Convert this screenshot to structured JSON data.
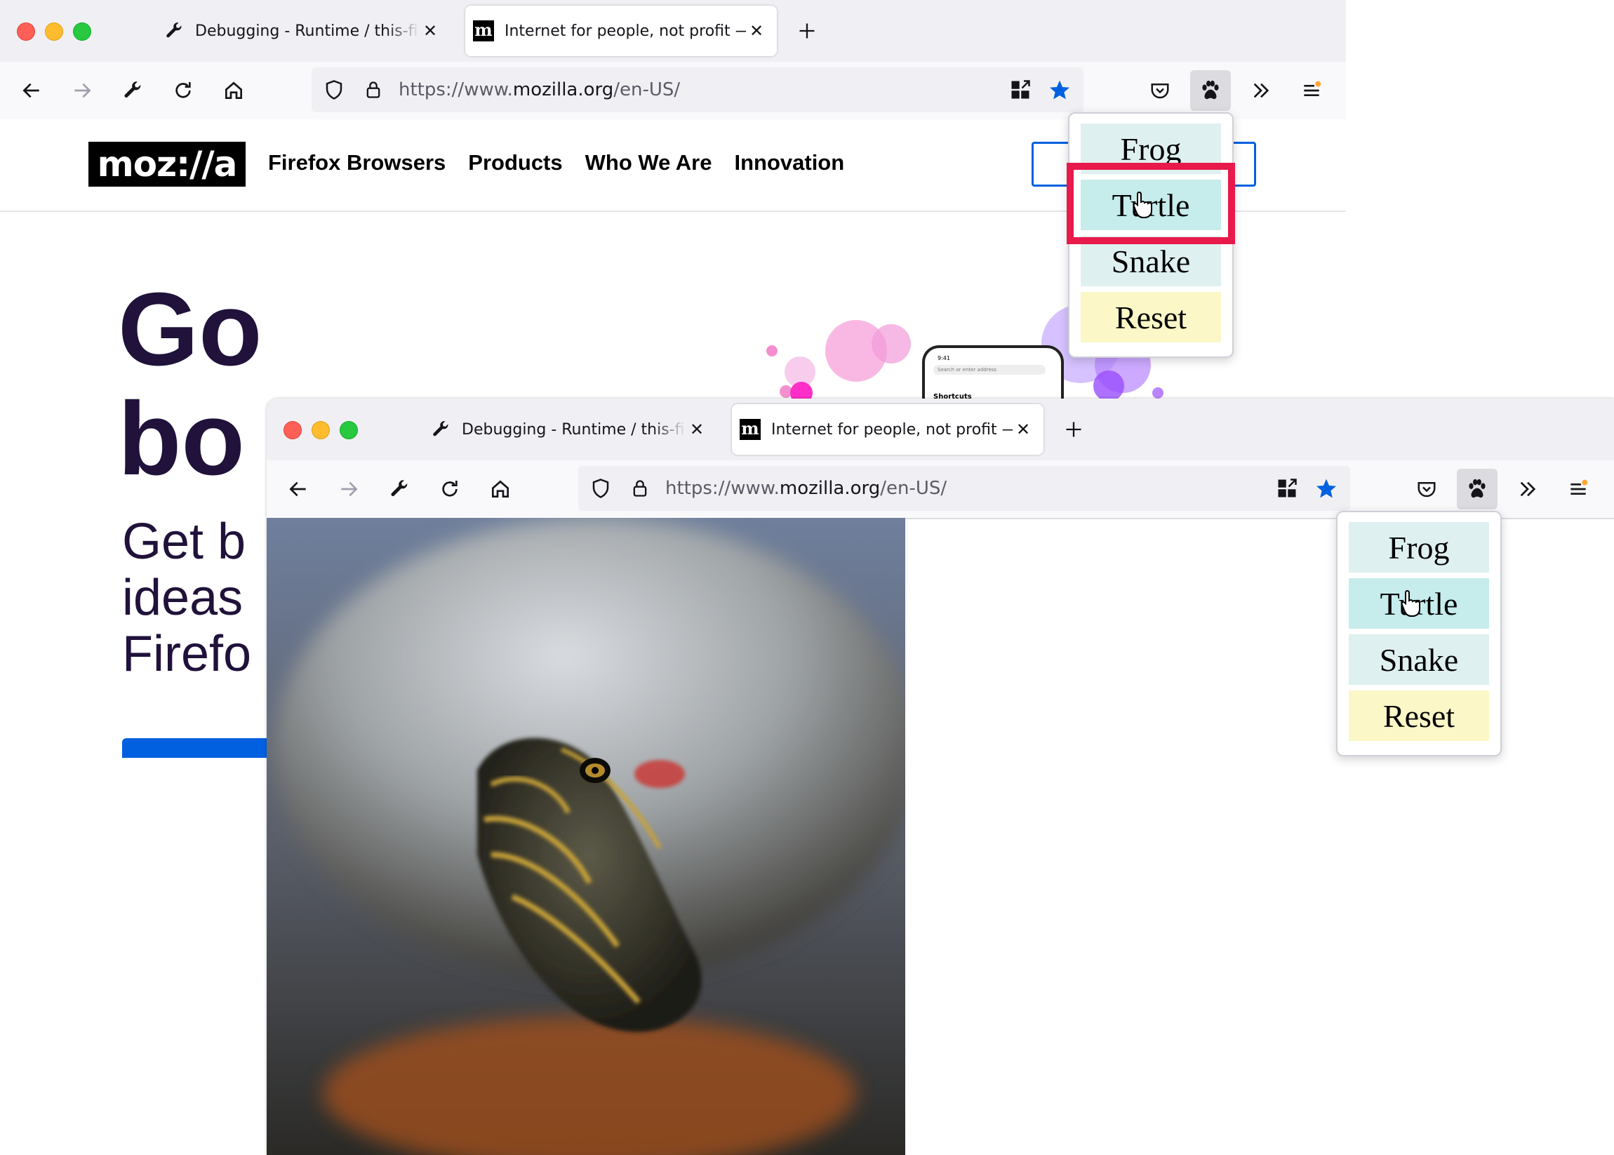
{
  "windows": [
    {
      "id": "back",
      "tabs": [
        {
          "label": "Debugging - Runtime / this-firefox"
        },
        {
          "label": "Internet for people, not profit — Mozilla"
        }
      ],
      "url": {
        "prefix": "https://www.",
        "domain": "mozilla.org",
        "path": "/en-US/"
      },
      "site": {
        "logo": "moz://a",
        "nav": [
          "Firefox Browsers",
          "Products",
          "Who We Are",
          "Innovation"
        ],
        "hero_title": [
          "Go",
          "bo"
        ],
        "hero_sub": [
          "Get b",
          "ideas",
          "Firefo"
        ],
        "phone": {
          "time": "9:41",
          "search": "Search or enter address",
          "shortcuts": "Shortcuts"
        }
      }
    },
    {
      "id": "front",
      "tabs": [
        {
          "label": "Debugging - Runtime / this-firefox"
        },
        {
          "label": "Internet for people, not profit — Mozilla"
        }
      ],
      "url": {
        "prefix": "https://www.",
        "domain": "mozilla.org",
        "path": "/en-US/"
      },
      "content": {
        "image": "turtle-photo"
      }
    }
  ],
  "popup": {
    "items": [
      "Frog",
      "Turtle",
      "Snake",
      "Reset"
    ],
    "hovered": "Turtle"
  },
  "colors": {
    "accent_blue": "#0060df",
    "highlight_red": "#e8194b",
    "animal_bg": "#dff0f0",
    "reset_bg": "#fbf7c7",
    "hero_text": "#20123a"
  }
}
